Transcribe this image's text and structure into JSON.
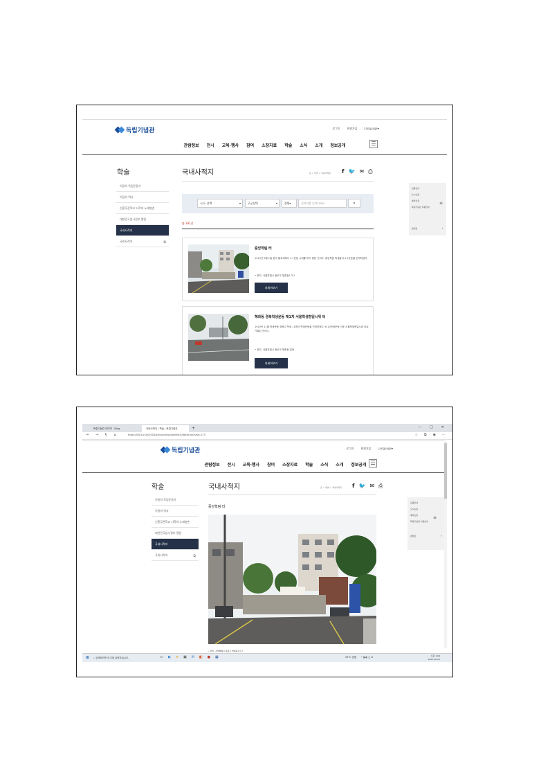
{
  "site": {
    "logo_text": "독립기념관",
    "util_links": [
      "로그인",
      "회원가입",
      "Language▾"
    ],
    "gnb": [
      "관람정보",
      "전시",
      "교육·행사",
      "참여",
      "소장자료",
      "학술",
      "소식",
      "소개",
      "정보공개"
    ],
    "menu_icon": "hamburger-icon"
  },
  "lnb": {
    "title": "학술",
    "items": [
      "이달의 독립운동가",
      "이달의 역사",
      "신흥무관학교 사학의 노래병촌",
      "대한민국임시정부 열람",
      "국내사적지",
      "국외사적지"
    ],
    "active_index": 4
  },
  "content": {
    "page_title": "국내사적지",
    "breadcrumb": "홈 > 학술 > 국내사적지",
    "share_icons": [
      "facebook-icon",
      "twitter-icon",
      "mail-icon",
      "print-icon"
    ]
  },
  "search": {
    "sido": "시·도 선택",
    "gugun": "구군선택",
    "scope": "전체",
    "placeholder": "검색어를 입력하세요",
    "button_icon": "search-icon"
  },
  "results": {
    "count": "총 392건",
    "items": [
      {
        "title": "중앙학림 터",
        "desc": "1919년 3월 1일 한국 불교계에서 3·1운동 시위를 하기 위한 곳이다. 중앙학림 학생들이 3·1운동을 전개하였다.",
        "loc": "• 위치: 서울특별시 종로구 명륜동1가 2",
        "button": "자세히보기"
      },
      {
        "title": "혜화동 경북학생운동 제1차 서울학생항일시위 터",
        "desc": "1929년 11월 학생운동 경북고 학생 11명이 학생운동을 전개하였다. 6·10만세운동 이후 서울학생항일시위 터로 기록된 곳이다.",
        "loc": "• 위치: 서울특별시 종로구 혜화동 일대",
        "button": "자세히보기"
      }
    ]
  },
  "quick_menu": {
    "items": [
      "관람안내",
      "오시는길",
      "예약신청",
      "독립기념관 이용안내"
    ],
    "top": "맨위로"
  },
  "browser": {
    "tab1": "독립기념관 이미지 - Bing",
    "tab2": "국내사적지 | 학술 | 독립기념관",
    "url": "https://i815.or.kr/2018/scholarship/domestic/detail.do?seq=273",
    "window_controls": [
      "—",
      "□",
      "✕"
    ]
  },
  "detail": {
    "title": "중앙학림 터",
    "caption": "• 위치: 서울특별시 종로구 명륜동1가 2"
  },
  "taskbar": {
    "search_placeholder": "검색하려면 여기에 입력하십시오.",
    "weather": "25°C 흐림",
    "time": "오후 1:09",
    "date": "2021-06-22"
  },
  "colors": {
    "brand": "#1b4f9a",
    "active_nav": "#243148",
    "search_bg": "#e8edf4",
    "count_red": "#c0392b"
  }
}
